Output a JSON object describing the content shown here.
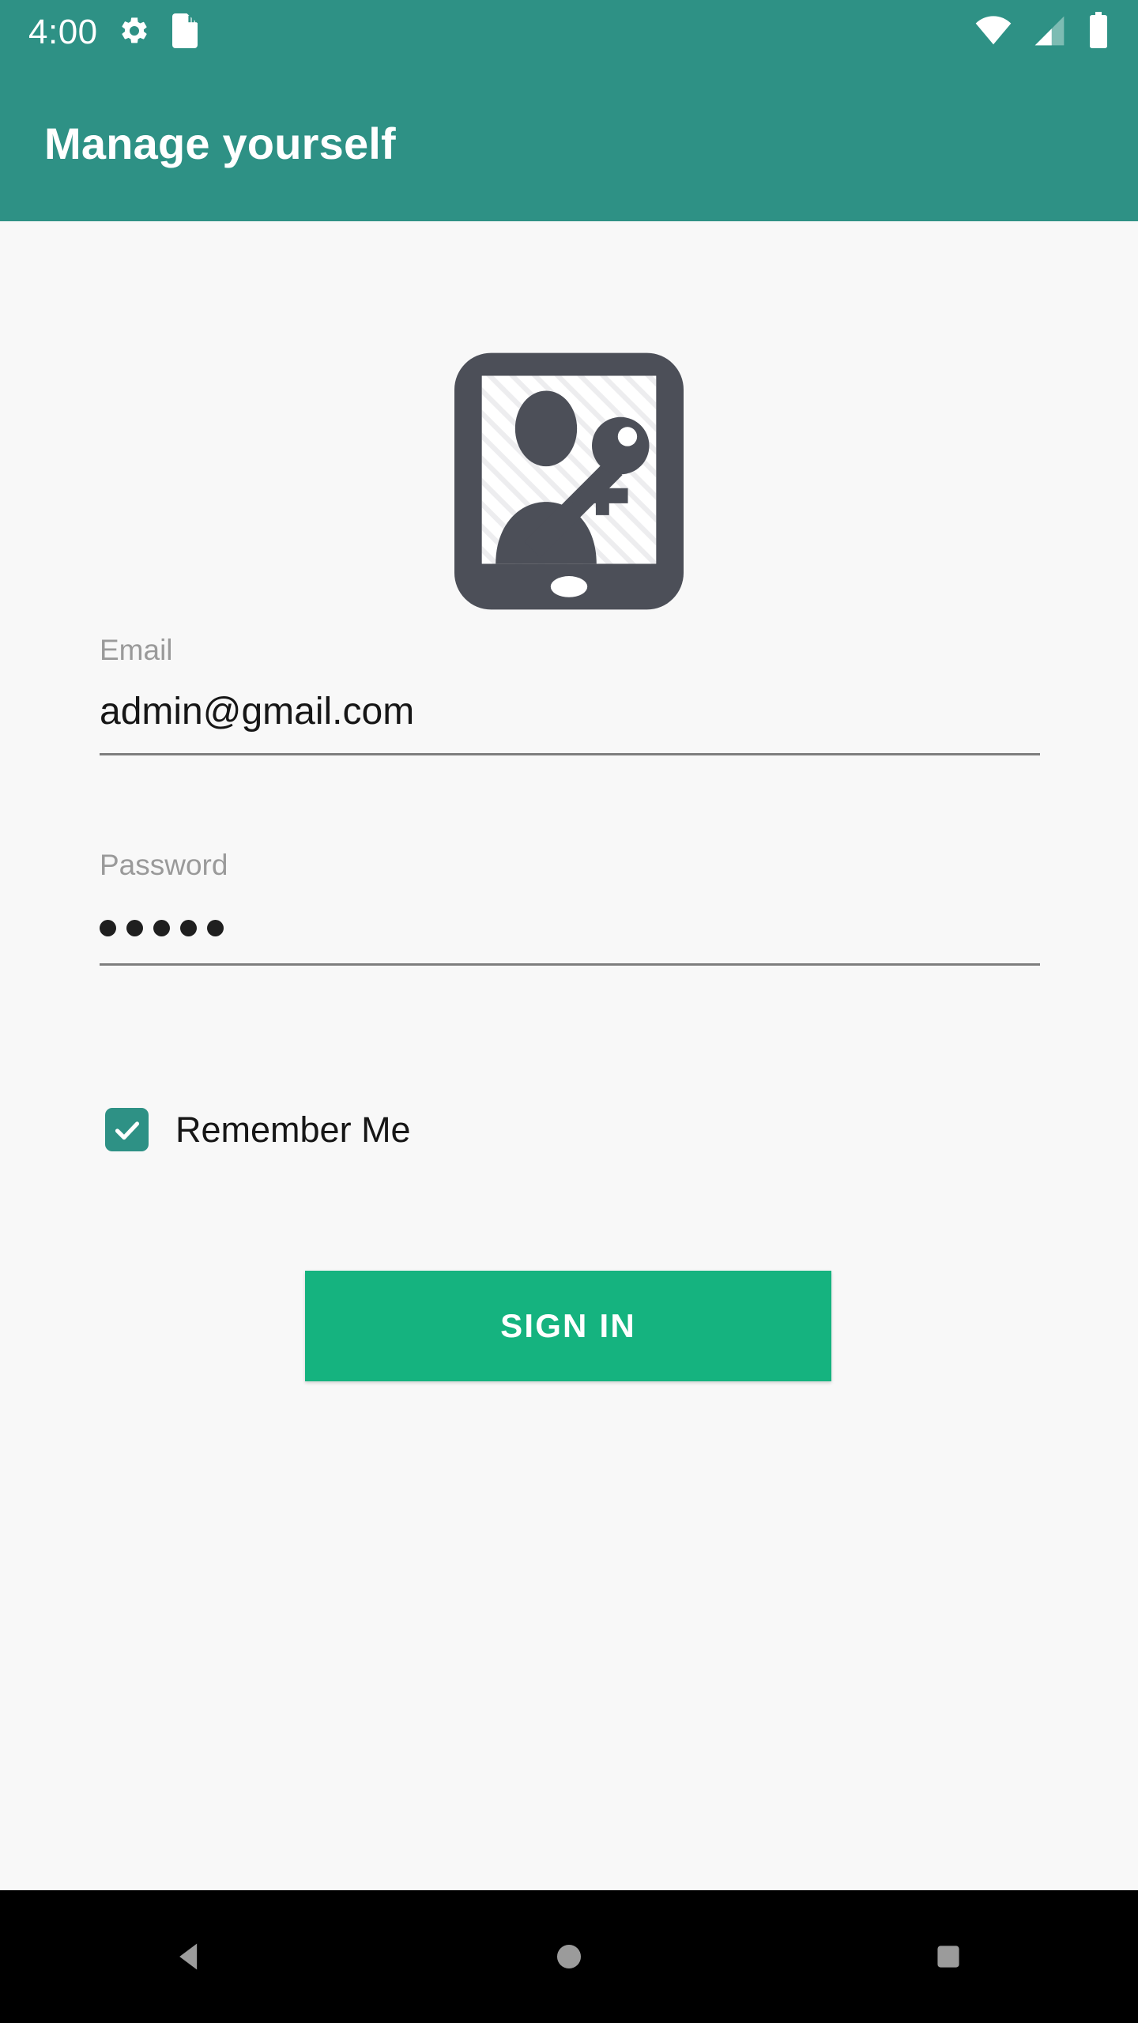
{
  "status_bar": {
    "clock": "4:00",
    "left_icons": [
      {
        "name": "settings-gear-icon",
        "label": "Settings"
      },
      {
        "name": "sd-card-icon",
        "label": "SD card"
      }
    ],
    "right_icons": [
      {
        "name": "wifi-icon",
        "label": "Wi-Fi full signal"
      },
      {
        "name": "cellular-signal-icon",
        "label": "Cellular signal"
      },
      {
        "name": "battery-icon",
        "label": "Battery full"
      }
    ],
    "background_color": "#2e9185",
    "foreground_color": "#ffffff"
  },
  "app_bar": {
    "title": "Manage yourself",
    "background_color": "#2e9185",
    "title_color": "#ffffff"
  },
  "logo": {
    "name": "tablet-user-key-icon",
    "alt": "Tablet showing a user silhouette with a key",
    "body_color": "#4c4f58",
    "screen_color": "#ffffff"
  },
  "form": {
    "email": {
      "label": "Email",
      "value": "admin@gmail.com",
      "placeholder": "Email"
    },
    "password": {
      "label": "Password",
      "value": "•••••",
      "masked_char_count": 5,
      "placeholder": "Password"
    },
    "remember_me": {
      "label": "Remember Me",
      "checked": true,
      "checkbox_color": "#2e9185"
    },
    "submit": {
      "label": "SIGN IN",
      "background_color": "#15b37f",
      "text_color": "#ffffff"
    }
  },
  "nav_bar": {
    "background_color": "#000000",
    "icon_color": "#9b9b9b",
    "buttons": [
      {
        "name": "nav-back-button",
        "label": "Back"
      },
      {
        "name": "nav-home-button",
        "label": "Home"
      },
      {
        "name": "nav-recents-button",
        "label": "Recents"
      }
    ]
  },
  "theme": {
    "background": "#f8f8f8",
    "primary": "#2e9185",
    "accent": "#15b37f",
    "text": "#161616",
    "muted_text": "#9a9a9a",
    "underline": "#7e7e7e"
  }
}
